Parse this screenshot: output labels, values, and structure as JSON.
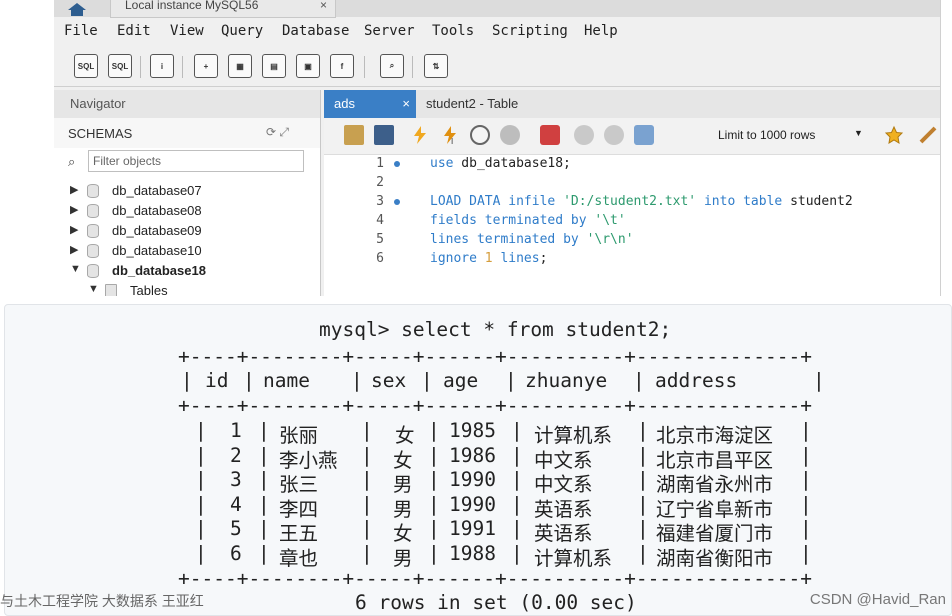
{
  "window": {
    "connection_tab": "Local instance MySQL56",
    "close_glyph": "×"
  },
  "menu": [
    "File",
    "Edit",
    "View",
    "Query",
    "Database",
    "Server",
    "Tools",
    "Scripting",
    "Help"
  ],
  "navigator": {
    "title": "Navigator",
    "schemas_label": "SCHEMAS",
    "filter_placeholder": "Filter objects",
    "schemas": [
      {
        "name": "db_database07",
        "expanded": false
      },
      {
        "name": "db_database08",
        "expanded": false
      },
      {
        "name": "db_database09",
        "expanded": false
      },
      {
        "name": "db_database10",
        "expanded": false
      },
      {
        "name": "db_database18",
        "expanded": true
      },
      {
        "name": "Tables",
        "expanded": true
      }
    ]
  },
  "editor": {
    "tabs": [
      "ads",
      "student2 - Table"
    ],
    "limit_label": "Limit to 1000 rows",
    "line_numbers": [
      "1",
      "2",
      "3",
      "4",
      "5",
      "6"
    ],
    "code_lines": [
      "use db_database18;",
      "",
      "LOAD DATA infile 'D:/student2.txt' into table student2",
      "fields terminated by '\\t'",
      "lines terminated by '\\r\\n'",
      "ignore 1 lines;"
    ]
  },
  "console": {
    "prompt": "mysql> select * from student2;",
    "border_line": "+----+--------+-----+------+----------+--------------+",
    "headers": [
      "id",
      "name",
      "sex",
      "age",
      "zhuanye",
      "address"
    ],
    "rows": [
      [
        "1",
        "张丽",
        "女",
        "1985",
        "计算机系",
        "北京市海淀区"
      ],
      [
        "2",
        "李小燕",
        "女",
        "1986",
        "中文系",
        "北京市昌平区"
      ],
      [
        "3",
        "张三",
        "男",
        "1990",
        "中文系",
        "湖南省永州市"
      ],
      [
        "4",
        "李四",
        "男",
        "1990",
        "英语系",
        "辽宁省阜新市"
      ],
      [
        "5",
        "王五",
        "女",
        "1991",
        "英语系",
        "福建省厦门市"
      ],
      [
        "6",
        "章也",
        "男",
        "1988",
        "计算机系",
        "湖南省衡阳市"
      ]
    ],
    "footer": "6 rows in set (0.00 sec)"
  },
  "watermarks": {
    "left": "与土木工程学院 大数据系 王亚红",
    "right": "CSDN @Havid_Ran"
  }
}
